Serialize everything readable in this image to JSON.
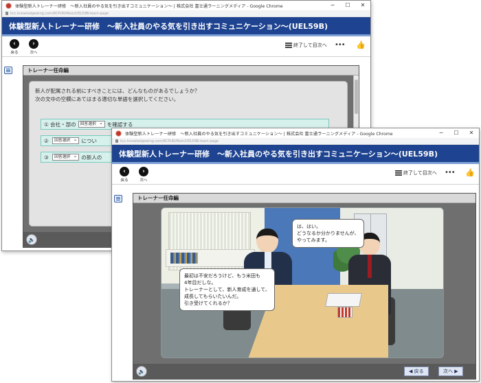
{
  "window_back": {
    "title": "体験型新人トレーナー研修　～新入社員のやる気を引き出すコミュニケーション～ | 株式会社 富士通ラーニングメディア - Google Chrome",
    "url": "kcc.knowledgewing.com/KCPUR/Main/UEL59B-learn-page",
    "banner": "体験型新人トレーナー研修　～新入社員のやる気を引き出すコミュニケーション～(UEL59B)",
    "back_label": "戻る",
    "next_label": "次へ",
    "exit_label": "終了して目次へ",
    "section_title": "トレーナー任命編",
    "question_line1": "新人が配属される前にすべきことには、どんなものがあるでしょうか？",
    "question_line2": "次の文中の空欄にあてはまる適切な単語を選択してください。",
    "rows": [
      {
        "number": "①",
        "prefix": "会社・部の",
        "select": "回答選択",
        "suffix": "を確認する"
      },
      {
        "number": "②",
        "prefix": "",
        "select": "回答選択",
        "suffix": "につい"
      },
      {
        "number": "③",
        "prefix": "",
        "select": "回答選択",
        "suffix": "の新人の"
      }
    ]
  },
  "window_front": {
    "title": "体験型新人トレーナー研修　～新入社員のやる気を引き出すコミュニケーション～ | 株式会社 富士通ラーニングメディア - Google Chrome",
    "url": "kcc.knowledgewing.com/KCPUR/Main/UEL59B-learn-page",
    "banner": "体験型新人トレーナー研修　～新入社員のやる気を引き出すコミュニケーション～(UEL59B)",
    "back_label": "戻る",
    "next_label": "次へ",
    "exit_label": "終了して目次へ",
    "section_title": "トレーナー任命編",
    "bubble_right": [
      "は、はい。",
      "どうなるか分かりませんが、",
      "やってみます。"
    ],
    "bubble_left": [
      "最初は不安だろうけど、もう米田も",
      "4年目だしな。",
      "トレーナーとして、新人育成を通して、",
      "成長してもらいたいんだ。",
      "引き受けてくれるか？"
    ],
    "footer_back": "◀ 戻る",
    "footer_next": "次へ ▶"
  },
  "icons": {
    "window_minimize": "minimize-icon",
    "window_maximize": "maximize-icon",
    "window_close": "close-icon",
    "more": "more-icon",
    "like": "thumbs-up-icon",
    "menu": "menu-list-icon",
    "audio": "speaker-icon"
  },
  "colors": {
    "banner": "#1e4390",
    "answer_row": "#d6f0ec",
    "answer_border": "#7cc8bf"
  }
}
